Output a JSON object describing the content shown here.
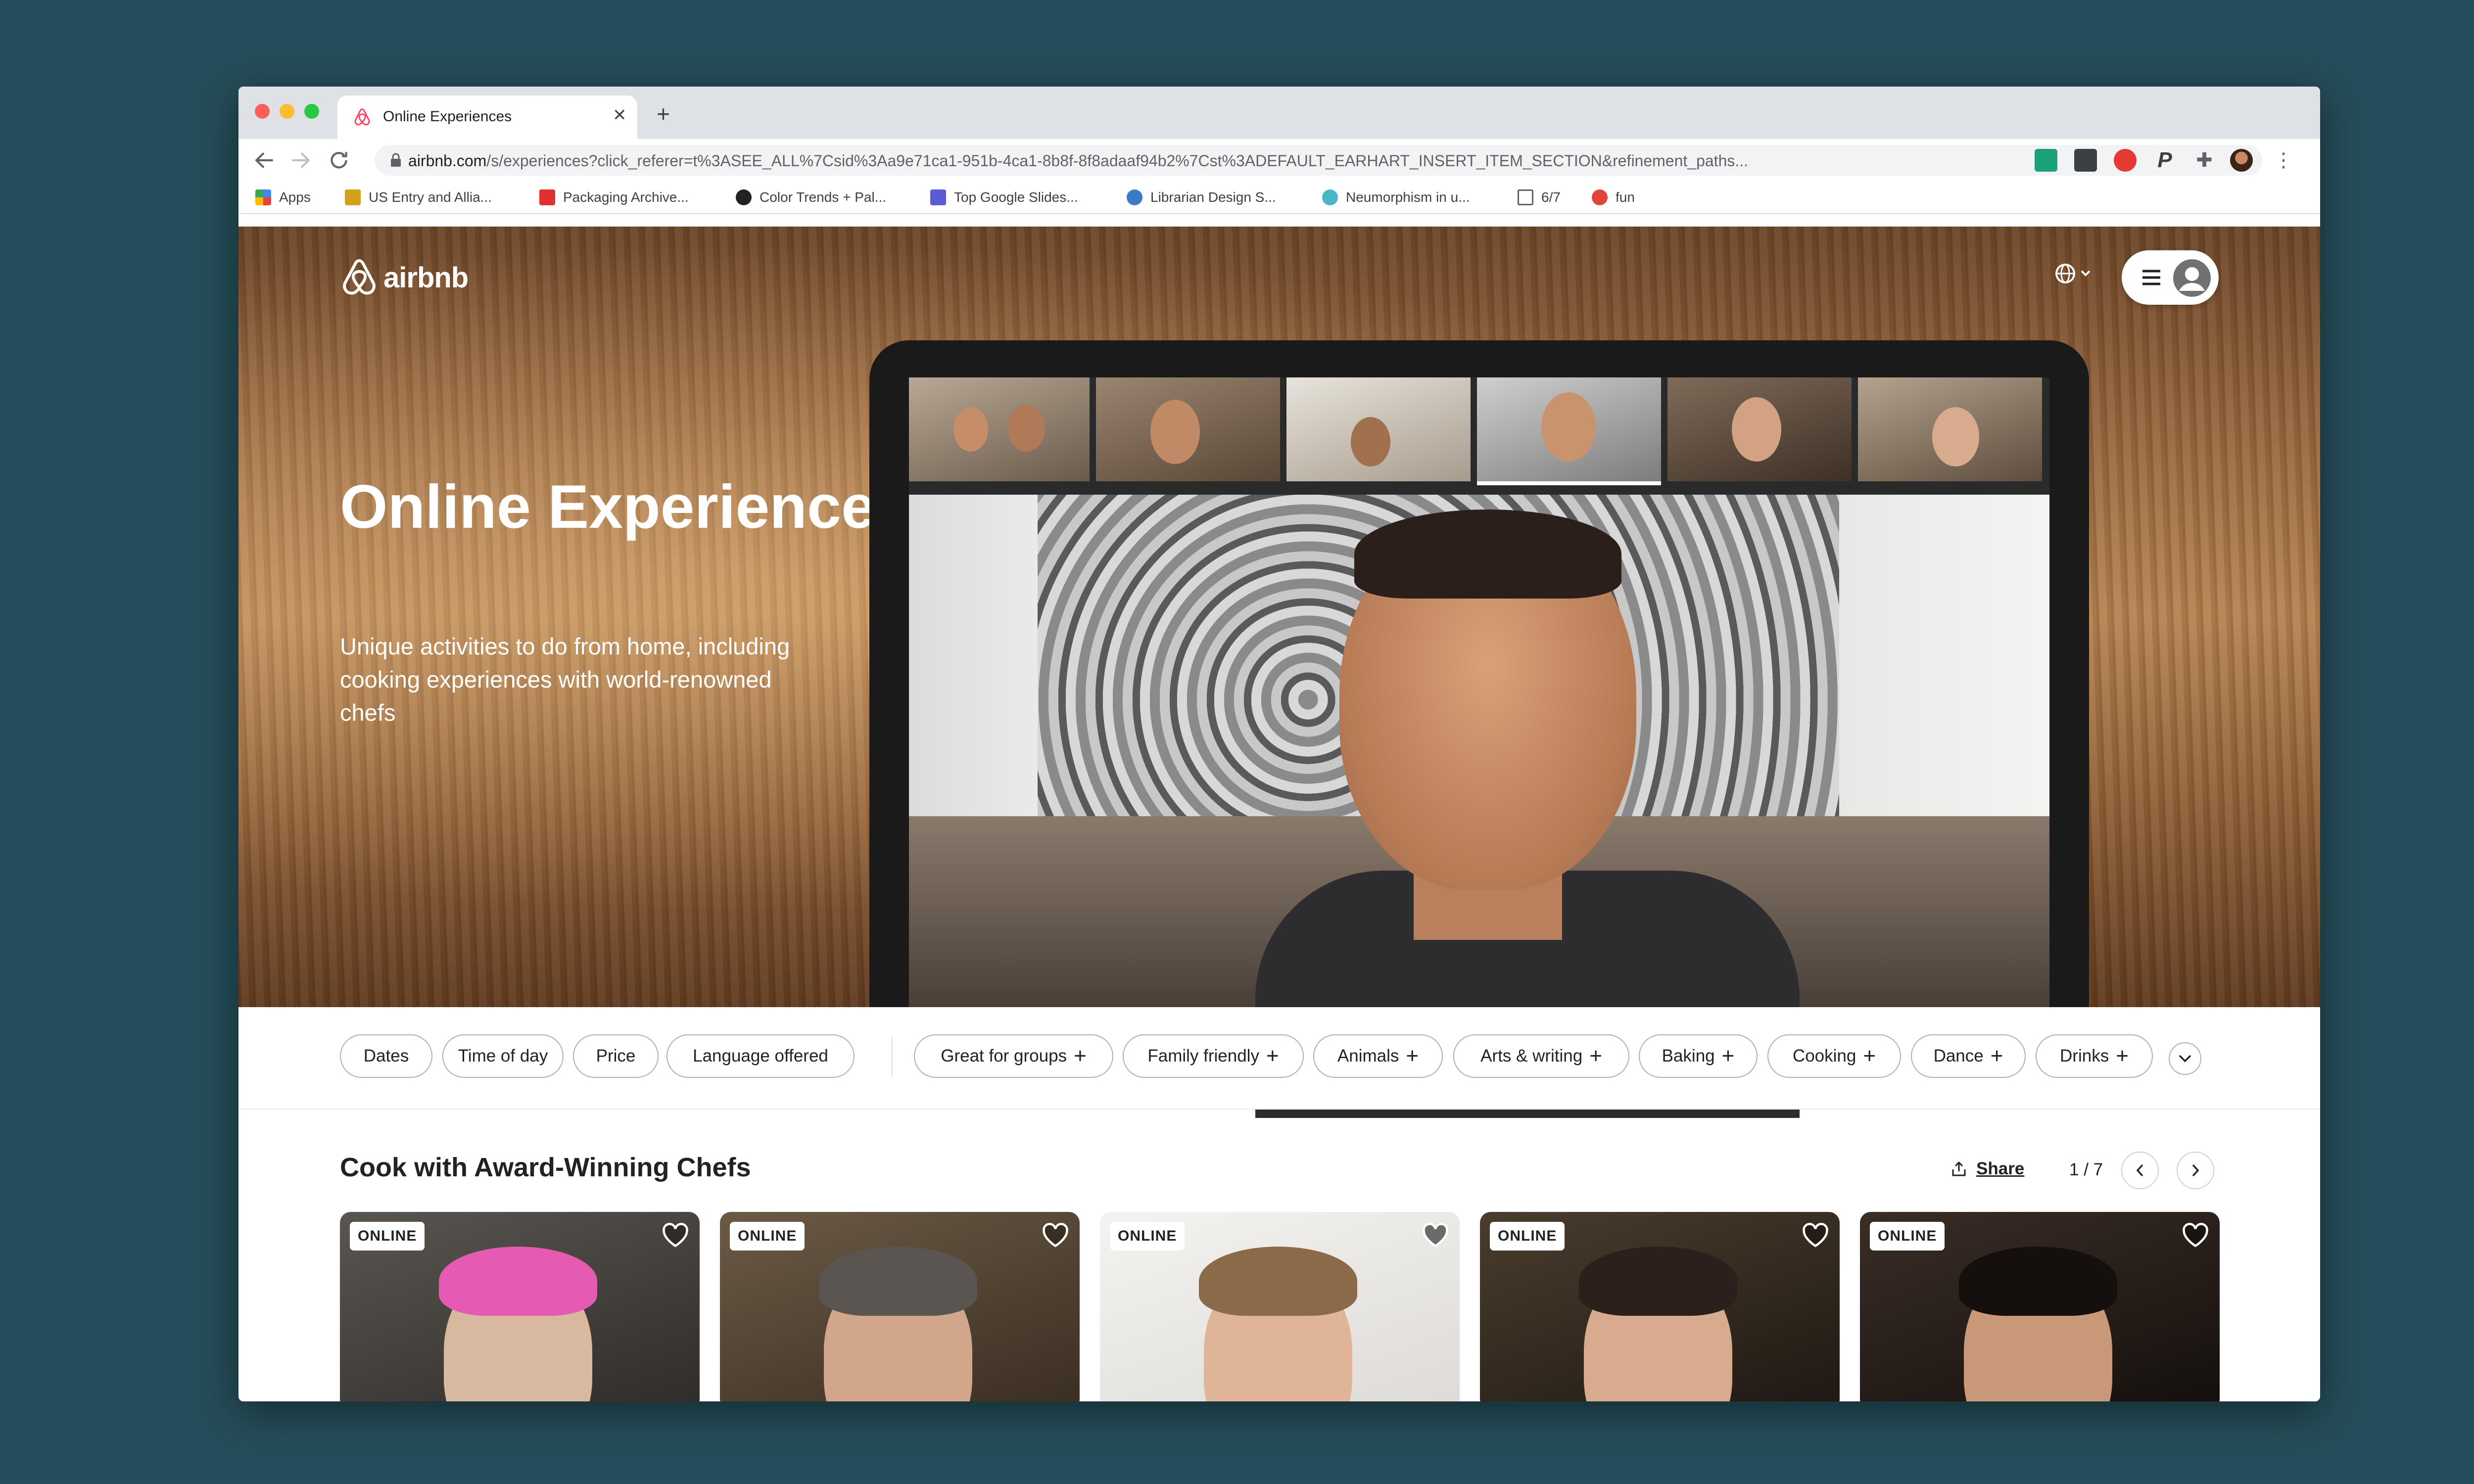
{
  "browser": {
    "tab_title": "Online Experiences",
    "new_tab_label": "+",
    "url_domain": "airbnb.com",
    "url_path": "/s/experiences?click_referer=t%3ASEE_ALL%7Csid%3Aa9e71ca1-951b-4ca1-8b8f-8f8adaaf94b2%7Cst%3ADEFAULT_EARHART_INSERT_ITEM_SECTION&refinement_paths..."
  },
  "bookmarks": [
    {
      "label": "Apps",
      "icon": "apps-grid-icon",
      "color": "#4285f4"
    },
    {
      "label": "US Entry and Allia...",
      "icon": "h-bookmark-icon",
      "color": "#d4a017"
    },
    {
      "label": "Packaging Archive...",
      "icon": "w-bookmark-icon",
      "color": "#e03030"
    },
    {
      "label": "Color Trends + Pal...",
      "icon": "heart-bookmark-icon",
      "color": "#222222"
    },
    {
      "label": "Top Google Slides...",
      "icon": "slides-bookmark-icon",
      "color": "#5b5bd6"
    },
    {
      "label": "Librarian Design S...",
      "icon": "wordpress-icon",
      "color": "#3a7bc8"
    },
    {
      "label": "Neumorphism in u...",
      "icon": "neumorphism-icon",
      "color": "#49b6c9"
    },
    {
      "label": "6/7",
      "icon": "folder-icon",
      "color": "#5f6368"
    },
    {
      "label": "fun",
      "icon": "fun-bookmark-icon",
      "color": "#e0443c"
    }
  ],
  "header": {
    "logo_text": "airbnb",
    "brand_color": "#ff385c"
  },
  "hero": {
    "title": "Online Experiences",
    "subtitle": "Unique activities to do from home, including cooking experiences with world-renowned chefs"
  },
  "filters": {
    "chips": [
      {
        "label": "Dates",
        "plus": ""
      },
      {
        "label": "Time of day",
        "plus": ""
      },
      {
        "label": "Price",
        "plus": ""
      },
      {
        "label": "Language offered",
        "plus": ""
      },
      {
        "label": "Great for groups",
        "plus": "+"
      },
      {
        "label": "Family friendly",
        "plus": "+"
      },
      {
        "label": "Animals",
        "plus": "+"
      },
      {
        "label": "Arts & writing",
        "plus": "+"
      },
      {
        "label": "Baking",
        "plus": "+"
      },
      {
        "label": "Cooking",
        "plus": "+"
      },
      {
        "label": "Dance",
        "plus": "+"
      },
      {
        "label": "Drinks",
        "plus": "+"
      }
    ]
  },
  "section": {
    "title": "Cook with Award-Winning Chefs",
    "share_label": "Share",
    "pager": "1 / 7"
  },
  "cards": [
    {
      "badge": "ONLINE",
      "heart": "heart-outline-icon"
    },
    {
      "badge": "ONLINE",
      "heart": "heart-outline-icon"
    },
    {
      "badge": "ONLINE",
      "heart": "heart-filled-icon"
    },
    {
      "badge": "ONLINE",
      "heart": "heart-outline-icon"
    },
    {
      "badge": "ONLINE",
      "heart": "heart-outline-icon"
    }
  ]
}
